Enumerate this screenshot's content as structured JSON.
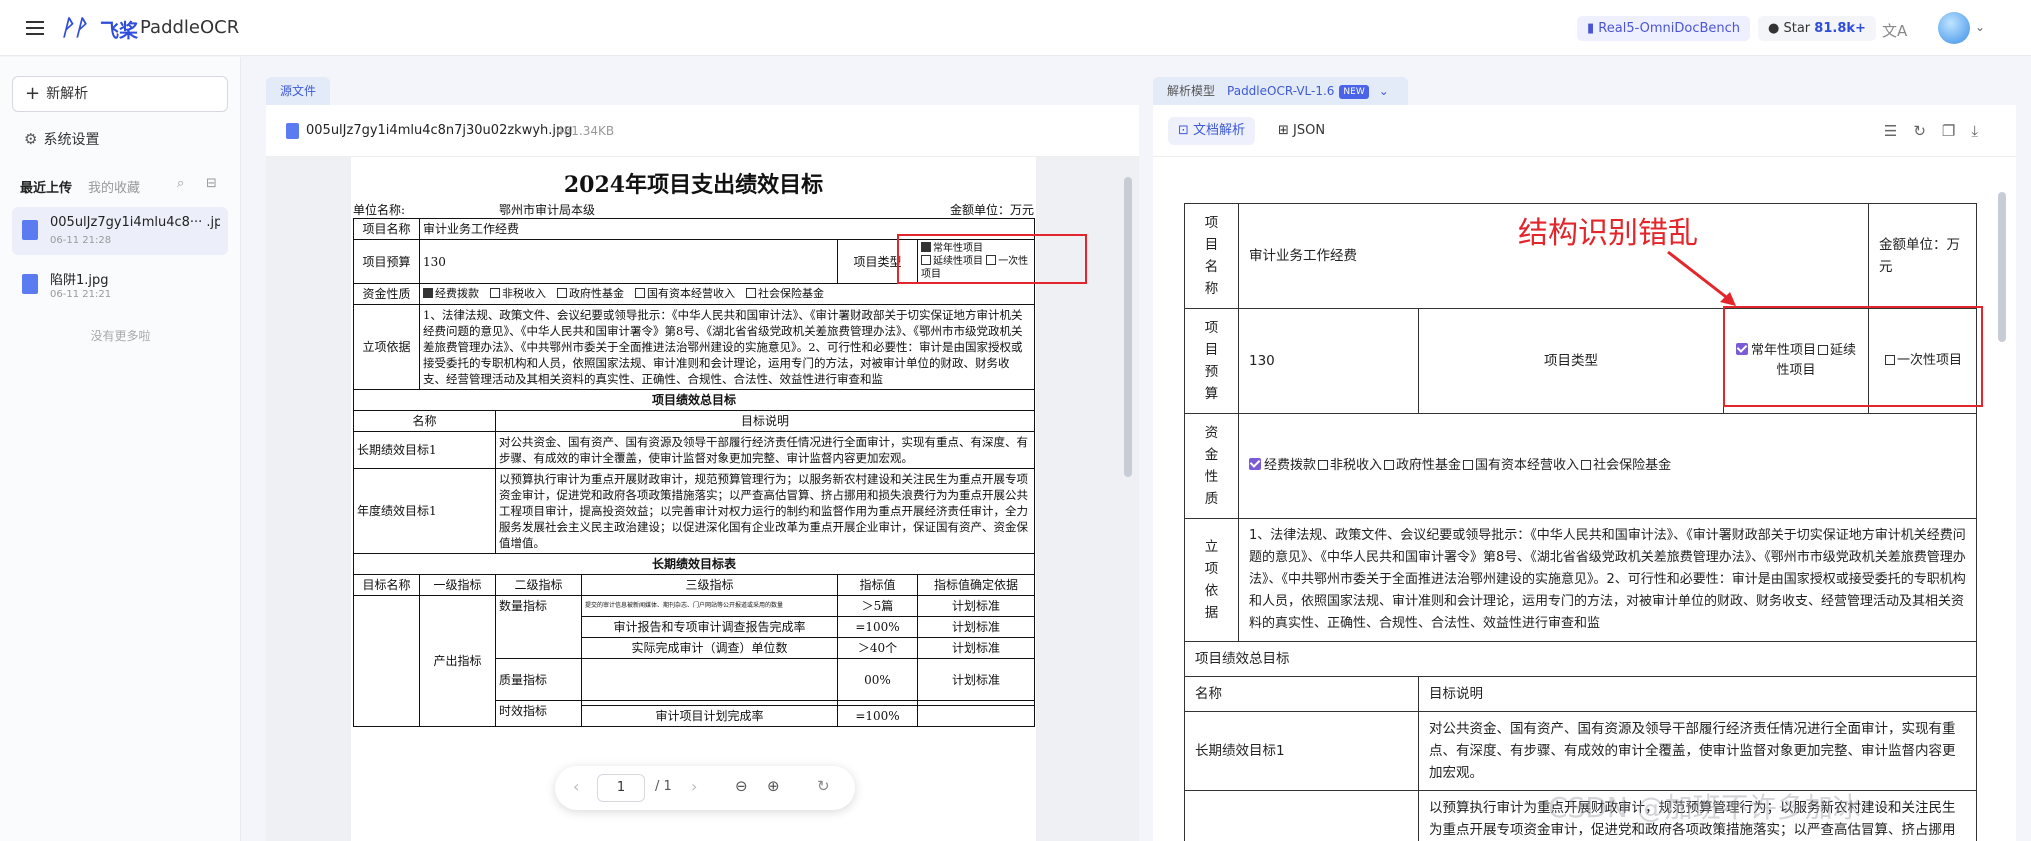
{
  "header": {
    "logo_mark": "ᚹᚹ",
    "logo_cn": "飞桨",
    "app_name": "PaddleOCR",
    "bench_label": "Real5-OmniDocBench",
    "star_label": "Star",
    "star_count": "81.8k+"
  },
  "sidebar": {
    "new_button": "新解析",
    "settings": "系统设置",
    "tab_recent": "最近上传",
    "tab_favorites": "我的收藏",
    "files": [
      {
        "name": "005ulJz7gy1i4mlu4c8··· .jpg",
        "date": "06-11 21:28"
      },
      {
        "name": "陷阱1.jpg",
        "date": "06-11 21:21"
      }
    ],
    "no_more": "没有更多啦"
  },
  "source": {
    "tab": "源文件",
    "file_name": "005ulJz7gy1i4mlu4c8n7j30u02zkwyh.jpg",
    "file_size": "481.34KB"
  },
  "doc": {
    "title": "2024年项目支出绩效目标",
    "unit_name_label": "单位名称:",
    "unit_name": "鄂州市审计局本级",
    "amount_unit": "金额单位：万元",
    "r1_label": "项目名称",
    "r1_value": "审计业务工作经费",
    "r2_label": "项目预算",
    "r2_value": "130",
    "r2_type_label": "项目类型",
    "type_a": "常年性项目",
    "type_b": "延续性项目",
    "type_c": "一次性项目",
    "r3_label": "资金性质",
    "fund_a": "经费拨款",
    "fund_b": "非税收入",
    "fund_c": "政府性基金",
    "fund_d": "国有资本经营收入",
    "fund_e": "社会保险基金",
    "basis_label": "立项依据",
    "basis_text": "1、法律法规、政策文件、会议纪要或领导批示：《中华人民共和国审计法》、《审计署财政部关于切实保证地方审计机关经费问题的意见》、《中华人民共和国审计署令》第8号、《湖北省省级党政机关差旅费管理办法》、《鄂州市市级党政机关差旅费管理办法》、《中共鄂州市委关于全面推进法治鄂州建设的实施意见》。2、可行性和必要性：审计是由国家授权或接受委托的专职机构和人员，依照国家法规、审计准则和会计理论，运用专门的方法，对被审计单位的财政、财务收支、经营管理活动及其相关资料的真实性、正确性、合规性、合法性、效益性进行审查和监",
    "overall_header": "项目绩效总目标",
    "col_name": "名称",
    "col_desc": "目标说明",
    "lt_label": "长期绩效目标1",
    "lt_text": "对公共资金、国有资产、国有资源及领导干部履行经济责任情况进行全面审计，实现有重点、有深度、有步骤、有成效的审计全覆盖，使审计监督对象更加完整、审计监督内容更加宏观。",
    "yr_label": "年度绩效目标1",
    "yr_text": "以预算执行审计为重点开展财政审计，规范预算管理行为；以服务新农村建设和关注民生为重点开展专项资金审计，促进党和政府各项政策措施落实；以严查高估冒算、挤占挪用和损失浪费行为为重点开展公共工程项目审计，提高投资效益；以完善审计对权力运行的制约和监督作用为重点开展经济责任审计，全力服务发展社会主义民主政治建设；以促进深化国有企业改革为重点开展企业审计，保证国有资产、资金保值增值。",
    "lt_table_header": "长期绩效目标表",
    "h_goal": "目标名称",
    "h_l1": "一级指标",
    "h_l2": "二级指标",
    "h_l3": "三级指标",
    "h_val": "指标值",
    "h_basis": "指标值确定依据",
    "l1_output": "产出指标",
    "l2_qty": "数量指标",
    "l2_quality": "质量指标",
    "l2_time": "时效指标",
    "row_a_l3": "提交的审计信息被新闻媒体、期刊杂志、门户网站等公开报道或采用的数量",
    "row_a_val": "＞5篇",
    "row_a_basis": "计划标准",
    "row_b_l3": "审计报告和专项审计调查报告完成率",
    "row_b_val": "=100%",
    "row_b_basis": "计划标准",
    "row_c_l3": "实际完成审计（调查）单位数",
    "row_c_val": "＞40个",
    "row_c_basis": "计划标准",
    "row_d_val": "00%",
    "row_d_basis": "计划标准",
    "row_e_l3": "审计项目计划完成率",
    "row_e_val": "=100%"
  },
  "pager": {
    "page": "1",
    "total": "/ 1"
  },
  "result": {
    "label": "解析模型",
    "model": "PaddleOCR-VL-1.6",
    "badge": "NEW",
    "tab_doc": "文档解析",
    "tab_json": "JSON",
    "t_name_label": [
      "项",
      "目",
      "名",
      "称"
    ],
    "t_name_value": "审计业务工作经费",
    "t_amount": "金额单位：万元",
    "t_budget_label": [
      "项",
      "目",
      "预",
      "算"
    ],
    "t_budget_value": "130",
    "t_type_label": "项目类型",
    "t_type_a": "常年性项目",
    "t_type_a2": "延续性项目",
    "t_type_b": "一次性项目",
    "t_fund_label": [
      "资",
      "金",
      "性",
      "质"
    ],
    "t_fund_a": "经费拨款",
    "t_fund_b": "非税收入",
    "t_fund_c": "政府性基金",
    "t_fund_d": "国有资本经营收入",
    "t_fund_e": "社会保险基金",
    "t_basis_label": [
      "立",
      "项",
      "依",
      "据"
    ],
    "t_basis_text": "1、法律法规、政策文件、会议纪要或领导批示：《中华人民共和国审计法》、《审计署财政部关于切实保证地方审计机关经费问题的意见》、《中华人民共和国审计署令》第8号、《湖北省省级党政机关差旅费管理办法》、《鄂州市市级党政机关差旅费管理办法》、《中共鄂州市委关于全面推进法治鄂州建设的实施意见》。2、可行性和必要性：审计是由国家授权或接受委托的专职机构和人员，依照国家法规、审计准则和会计理论，运用专门的方法，对被审计单位的财政、财务收支、经营管理活动及其相关资料的真实性、正确性、合规性、合法性、效益性进行审查和监",
    "t_overall": "项目绩效总目标",
    "t_col_name": "名称",
    "t_col_desc": "目标说明",
    "t_lt_label": "长期绩效目标1",
    "t_lt_text": "对公共资金、国有资产、国有资源及领导干部履行经济责任情况进行全面审计，实现有重点、有深度、有步骤、有成效的审计全覆盖，使审计监督对象更加完整、审计监督内容更加宏观。",
    "t_yr_text": "以预算执行审计为重点开展财政审计，规范预算管理行为；以服务新农村建设和关注民生为重点开展专项资金审计，促进党和政府各项政策措施落实；以严查高估冒算、挤占挪用和损失浪费行为为重点开展公共工程项目审计"
  },
  "annotation": {
    "text": "结构识别错乱",
    "color": "#e3262b"
  },
  "watermark": "CSDN @加班不许多加冰"
}
